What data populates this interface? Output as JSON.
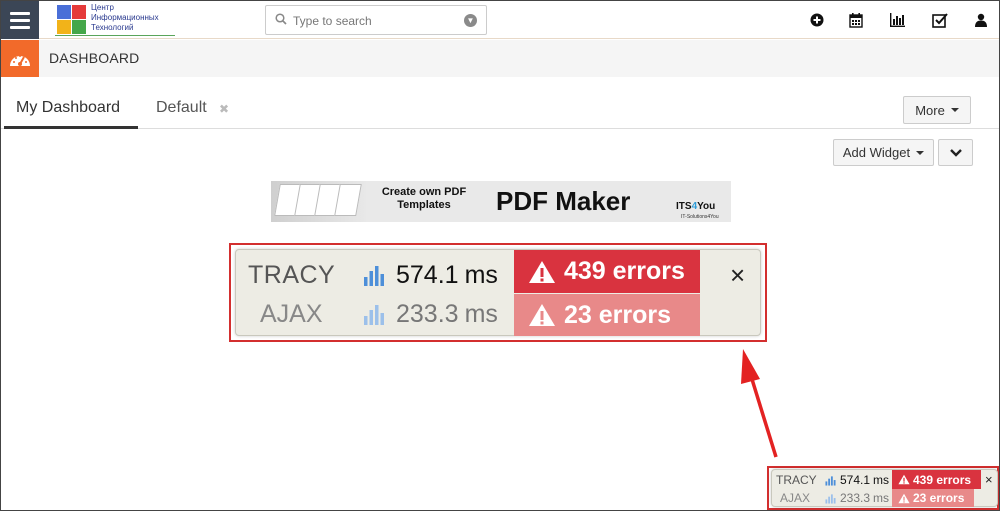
{
  "logo": {
    "text": "Центр\nИнформационных\nТехнологий"
  },
  "search": {
    "placeholder": "Type to search"
  },
  "header": {
    "icons": [
      "plus-circle-icon",
      "calendar-icon",
      "bar-chart-icon",
      "checkbox-icon",
      "user-icon"
    ]
  },
  "dashboard": {
    "title": "DASHBOARD"
  },
  "tabs": [
    {
      "label": "My Dashboard",
      "active": true
    },
    {
      "label": "Default",
      "active": false
    }
  ],
  "buttons": {
    "more": "More",
    "add_widget": "Add Widget"
  },
  "banner": {
    "tagline": "Create own PDF Templates",
    "product": "PDF Maker",
    "brand_pre": "ITS",
    "brand_num": "4",
    "brand_post": "You",
    "brand_sub": "IT-Solutions4You"
  },
  "tracy": {
    "rows": [
      {
        "name": "TRACY",
        "time": "574.1",
        "unit": "ms",
        "errors": "439 errors"
      },
      {
        "name": "AJAX",
        "time": "233.3",
        "unit": "ms",
        "errors": "23 errors"
      }
    ],
    "close": "×"
  },
  "colors": {
    "menu_bg": "#3b4656",
    "dashboard_accent": "#f26a2a",
    "error_primary": "#d9333f",
    "error_secondary": "#e88989",
    "callout": "#d32f2f"
  }
}
